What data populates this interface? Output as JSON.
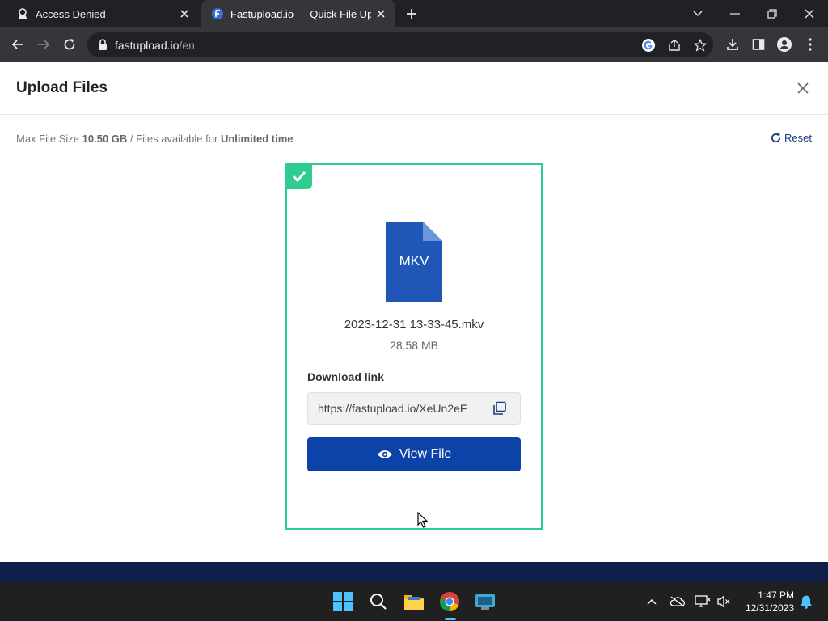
{
  "browser": {
    "tabs": [
      {
        "title": "Access Denied",
        "active": false
      },
      {
        "title": "Fastupload.io — Quick File Uploa",
        "active": true
      }
    ],
    "address": {
      "domain": "fastupload.io",
      "path": "/en"
    }
  },
  "modal": {
    "title": "Upload Files",
    "info": {
      "prefix": "Max File Size",
      "max_size": "10.50 GB",
      "middle": "/ Files available for",
      "availability": "Unlimited time"
    },
    "reset_label": "Reset"
  },
  "file": {
    "type_label": "MKV",
    "name": "2023-12-31 13-33-45.mkv",
    "size": "28.58 MB",
    "download_label": "Download link",
    "download_link": "https://fastupload.io/XeUn2eF",
    "view_button": "View File"
  },
  "taskbar": {
    "time": "1:47 PM",
    "date": "12/31/2023"
  },
  "colors": {
    "accent_green": "#2ecc8e",
    "button_blue": "#0b43a8",
    "file_icon_blue": "#1f56b8",
    "footer_navy": "#0f1e4a"
  }
}
